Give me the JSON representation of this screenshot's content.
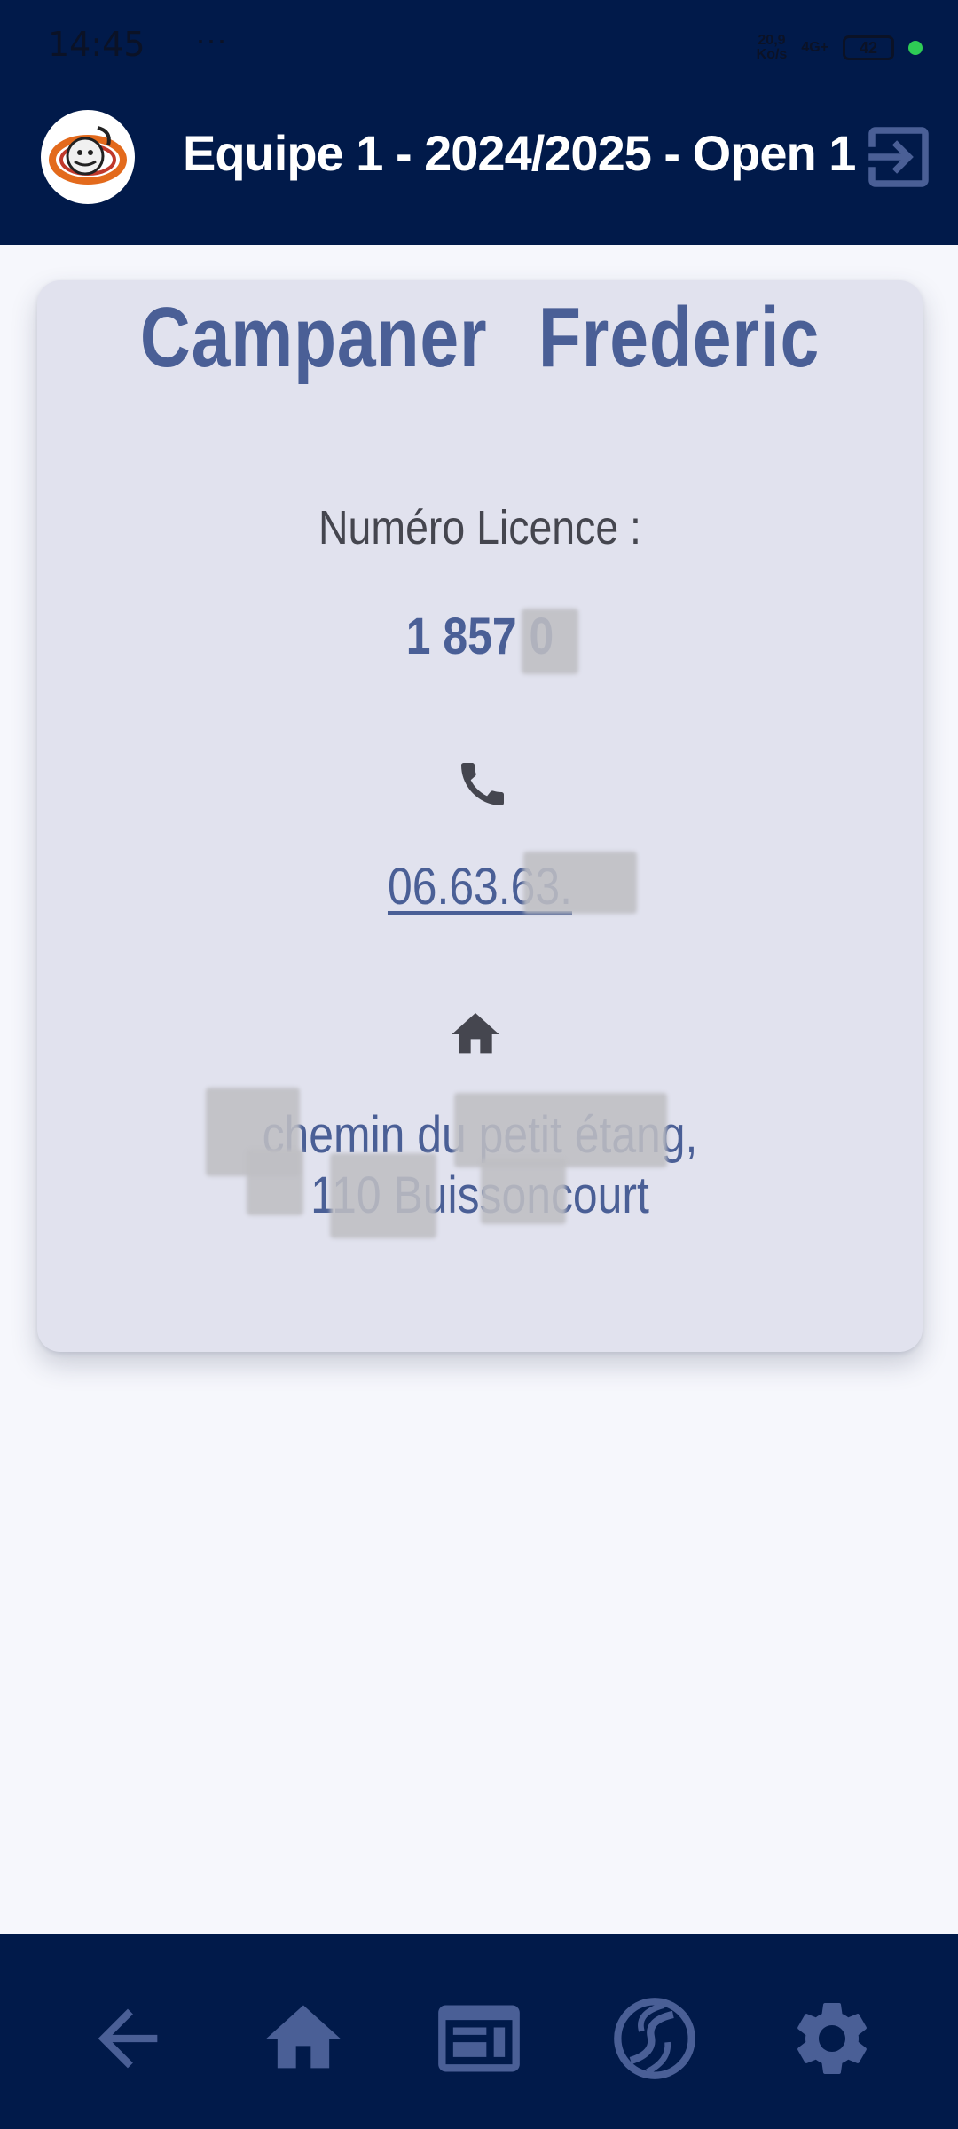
{
  "status_bar": {
    "time": "14:45",
    "more": "···",
    "net_speed_value": "20,9",
    "net_speed_unit": "Ko/s",
    "network": "4G+",
    "battery": "42"
  },
  "app_bar": {
    "title": "Equipe 1 - 2024/2025 - Open 1",
    "logo_icon": "club-logo",
    "logout_icon": "logout-icon"
  },
  "player": {
    "last_name": "Campaner",
    "first_name": "Frederic",
    "licence_label": "Numéro Licence :",
    "licence_number": "1 857 0",
    "phone_icon": "phone-icon",
    "phone": "06.63.63.",
    "home_icon": "home-icon",
    "address_line1": "chemin du petit étang,",
    "address_line2": "110 Buissoncourt"
  },
  "bottom_nav": {
    "items": [
      "back-arrow-icon",
      "home-icon",
      "dashboard-icon",
      "sports-icon",
      "settings-icon"
    ]
  },
  "colors": {
    "primary": "#011a4a",
    "accent": "#4a5f96",
    "card": "#e1e2ee",
    "background": "#f6f7fc"
  }
}
